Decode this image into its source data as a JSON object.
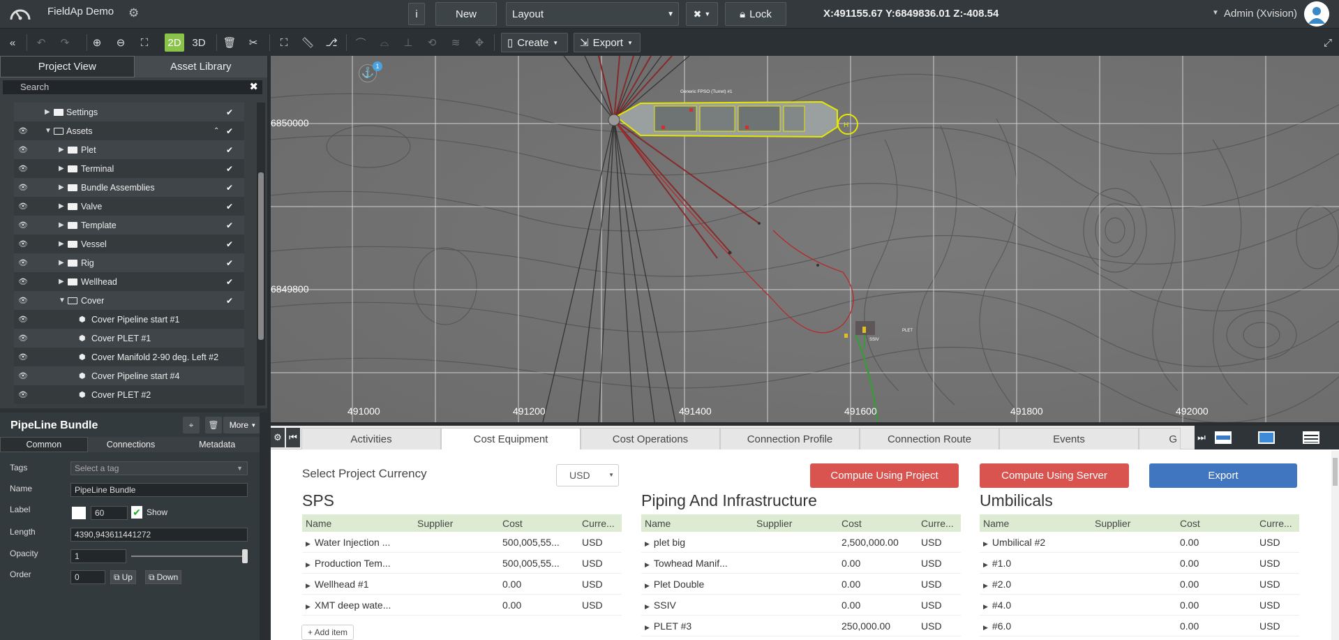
{
  "app": {
    "title": "FieldAp Demo",
    "user": "Admin (Xvision)"
  },
  "topbar": {
    "info_label": "i",
    "new_label": "New",
    "layout_select": "Layout",
    "lock_label": "Lock",
    "coords": "X:491155.67  Y:6849836.01  Z:-408.54"
  },
  "toolbar": {
    "mode_2d": "2D",
    "mode_3d": "3D",
    "create_label": "Create",
    "export_label": "Export"
  },
  "left": {
    "tabs": [
      "Project View",
      "Asset Library"
    ],
    "search_placeholder": "Search",
    "tree": [
      {
        "label": "Settings"
      },
      {
        "label": "Assets"
      },
      {
        "label": "Plet"
      },
      {
        "label": "Terminal"
      },
      {
        "label": "Bundle Assemblies"
      },
      {
        "label": "Valve"
      },
      {
        "label": "Template"
      },
      {
        "label": "Vessel"
      },
      {
        "label": "Rig"
      },
      {
        "label": "Wellhead"
      },
      {
        "label": "Cover"
      },
      {
        "label": "Cover Pipeline start #1"
      },
      {
        "label": "Cover PLET #1"
      },
      {
        "label": "Cover Manifold 2-90 deg. Left #2"
      },
      {
        "label": "Cover Pipeline start #4"
      },
      {
        "label": "Cover PLET #2"
      }
    ]
  },
  "props": {
    "title": "PipeLine Bundle",
    "more_label": "More",
    "tabs": [
      "Common",
      "Connections",
      "Metadata"
    ],
    "tags_label": "Tags",
    "tags_placeholder": "Select a tag",
    "name_label": "Name",
    "name_value": "PipeLine Bundle",
    "label_label": "Label",
    "label_size": "60",
    "show_label": "Show",
    "length_label": "Length",
    "length_value": "4390,943611441272",
    "opacity_label": "Opacity",
    "opacity_value": "1",
    "opacity_level": 1,
    "order_label": "Order",
    "order_value": "0",
    "up_label": "Up",
    "down_label": "Down"
  },
  "map": {
    "vessel_label": "Generic FPSO (Turret) #1",
    "anchor_badge": "1",
    "y_labels": [
      "6850000",
      "6849800"
    ],
    "x_labels": [
      "491000",
      "491200",
      "491400",
      "491600",
      "491800",
      "492000"
    ],
    "plet_label": "PLET",
    "ssiv_label": "SSIV"
  },
  "bottom": {
    "tabs": [
      "Activities",
      "Cost Equipment",
      "Cost Operations",
      "Connection Profile",
      "Connection Route",
      "Events",
      "G"
    ],
    "currency_label": "Select Project Currency",
    "currency_value": "USD",
    "btn_project": "Compute Using Project",
    "btn_server": "Compute Using Server",
    "btn_export": "Export",
    "add_item": "+ Add item",
    "columns": [
      "Name",
      "Supplier",
      "Cost",
      "Curre..."
    ],
    "sections": [
      {
        "title": "SPS",
        "rows": [
          [
            "Water Injection ...",
            "",
            "500,005,55...",
            "USD"
          ],
          [
            "Production Tem...",
            "",
            "500,005,55...",
            "USD"
          ],
          [
            "Wellhead #1",
            "",
            "0.00",
            "USD"
          ],
          [
            "XMT deep wate...",
            "",
            "0.00",
            "USD"
          ]
        ]
      },
      {
        "title": "Piping And Infrastructure",
        "rows": [
          [
            "plet big",
            "",
            "2,500,000.00",
            "USD"
          ],
          [
            "Towhead Manif...",
            "",
            "0.00",
            "USD"
          ],
          [
            "Plet Double",
            "",
            "0.00",
            "USD"
          ],
          [
            "SSIV",
            "",
            "0.00",
            "USD"
          ],
          [
            "PLET #3",
            "",
            "250,000.00",
            "USD"
          ]
        ]
      },
      {
        "title": "Umbilicals",
        "rows": [
          [
            "Umbilical #2",
            "",
            "0.00",
            "USD"
          ],
          [
            "#1.0",
            "",
            "0.00",
            "USD"
          ],
          [
            "#2.0",
            "",
            "0.00",
            "USD"
          ],
          [
            "#4.0",
            "",
            "0.00",
            "USD"
          ],
          [
            "#6.0",
            "",
            "0.00",
            "USD"
          ]
        ]
      }
    ]
  },
  "colors": {
    "accent_green": "#8bc34a",
    "danger": "#d9534f",
    "primary": "#3f76bf",
    "table_head": "#dcebd1"
  }
}
